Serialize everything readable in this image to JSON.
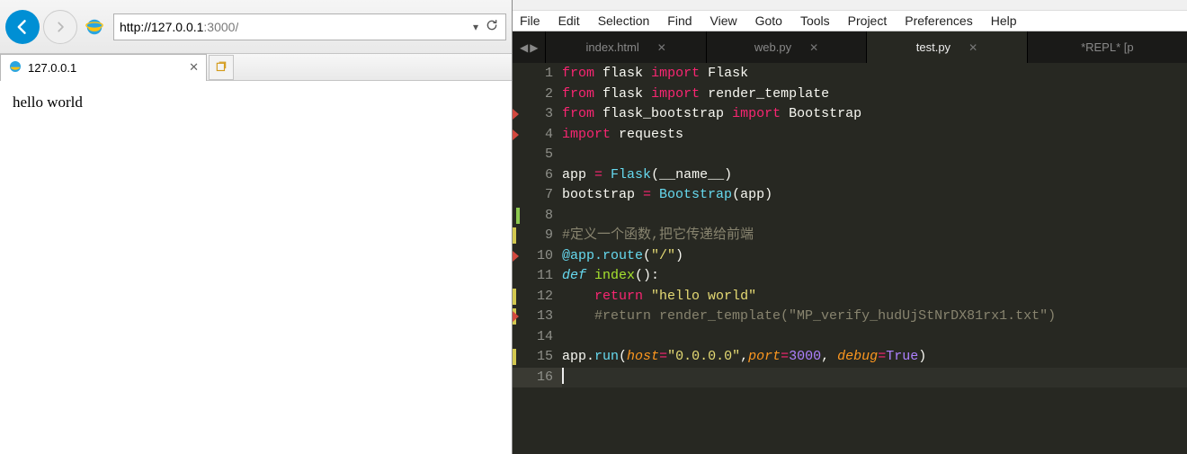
{
  "browser": {
    "url_proto_host": "http://127.0.0.1",
    "url_port_path": ":3000/",
    "tab": {
      "title": "127.0.0.1"
    },
    "page_text": "hello world"
  },
  "editor": {
    "menu": [
      "File",
      "Edit",
      "Selection",
      "Find",
      "View",
      "Goto",
      "Tools",
      "Project",
      "Preferences",
      "Help"
    ],
    "tabs": [
      {
        "label": "index.html",
        "active": false,
        "close": true
      },
      {
        "label": "web.py",
        "active": false,
        "close": true
      },
      {
        "label": "test.py",
        "active": true,
        "close": true
      },
      {
        "label": "*REPL* [p",
        "active": false,
        "close": false
      }
    ],
    "code": [
      {
        "n": 1,
        "marks": [],
        "tokens": [
          [
            "kw",
            "from"
          ],
          [
            " "
          ],
          [
            "name",
            "flask"
          ],
          [
            " "
          ],
          [
            "kw",
            "import"
          ],
          [
            " "
          ],
          [
            "name",
            "Flask"
          ]
        ]
      },
      {
        "n": 2,
        "marks": [],
        "tokens": [
          [
            "kw",
            "from"
          ],
          [
            " "
          ],
          [
            "name",
            "flask"
          ],
          [
            " "
          ],
          [
            "kw",
            "import"
          ],
          [
            " "
          ],
          [
            "name",
            "render_template"
          ]
        ]
      },
      {
        "n": 3,
        "marks": [
          "red"
        ],
        "tokens": [
          [
            "kw",
            "from"
          ],
          [
            " "
          ],
          [
            "name",
            "flask_bootstrap"
          ],
          [
            " "
          ],
          [
            "kw",
            "import"
          ],
          [
            " "
          ],
          [
            "name",
            "Bootstrap"
          ]
        ]
      },
      {
        "n": 4,
        "marks": [
          "red"
        ],
        "tokens": [
          [
            "kw",
            "import"
          ],
          [
            " "
          ],
          [
            "name",
            "requests"
          ]
        ]
      },
      {
        "n": 5,
        "marks": [],
        "tokens": []
      },
      {
        "n": 6,
        "marks": [],
        "tokens": [
          [
            "name",
            "app "
          ],
          [
            "op",
            "="
          ],
          [
            " "
          ],
          [
            "fn",
            "Flask"
          ],
          [
            "name",
            "(__name__)"
          ]
        ]
      },
      {
        "n": 7,
        "marks": [],
        "tokens": [
          [
            "name",
            "bootstrap "
          ],
          [
            "op",
            "="
          ],
          [
            " "
          ],
          [
            "fn",
            "Bootstrap"
          ],
          [
            "name",
            "(app)"
          ]
        ]
      },
      {
        "n": 8,
        "marks": [
          "green"
        ],
        "tokens": []
      },
      {
        "n": 9,
        "marks": [
          "yellow"
        ],
        "tokens": [
          [
            "cmt",
            "#定义一个函数,把它传递给前端"
          ]
        ]
      },
      {
        "n": 10,
        "marks": [
          "red"
        ],
        "tokens": [
          [
            "dec",
            "@app.route"
          ],
          [
            "name",
            "("
          ],
          [
            "str",
            "\"/\""
          ],
          [
            "name",
            ")"
          ]
        ]
      },
      {
        "n": 11,
        "marks": [],
        "tokens": [
          [
            "fn italic",
            "def"
          ],
          [
            " "
          ],
          [
            "cls",
            "index"
          ],
          [
            "name",
            "():"
          ]
        ]
      },
      {
        "n": 12,
        "marks": [
          "yellow"
        ],
        "tokens": [
          [
            "name",
            "    "
          ],
          [
            "kw",
            "return"
          ],
          [
            " "
          ],
          [
            "str",
            "\"hello world\""
          ]
        ]
      },
      {
        "n": 13,
        "marks": [
          "yellow",
          "red"
        ],
        "tokens": [
          [
            "name",
            "    "
          ],
          [
            "cmt",
            "#return render_template(\"MP_verify_hudUjStNrDX81rx1.txt\")"
          ]
        ]
      },
      {
        "n": 14,
        "marks": [],
        "tokens": []
      },
      {
        "n": 15,
        "marks": [
          "yellow"
        ],
        "tokens": [
          [
            "name",
            "app."
          ],
          [
            "fn",
            "run"
          ],
          [
            "name",
            "("
          ],
          [
            "arg",
            "host"
          ],
          [
            "op",
            "="
          ],
          [
            "str",
            "\"0.0.0.0\""
          ],
          [
            "name",
            ","
          ],
          [
            "arg",
            "port"
          ],
          [
            "op",
            "="
          ],
          [
            "num",
            "3000"
          ],
          [
            "name",
            ", "
          ],
          [
            "arg",
            "debug"
          ],
          [
            "op",
            "="
          ],
          [
            "const",
            "True"
          ],
          [
            "name",
            ")"
          ]
        ]
      },
      {
        "n": 16,
        "marks": [],
        "tokens": [],
        "cursor": true,
        "current": true
      }
    ]
  }
}
